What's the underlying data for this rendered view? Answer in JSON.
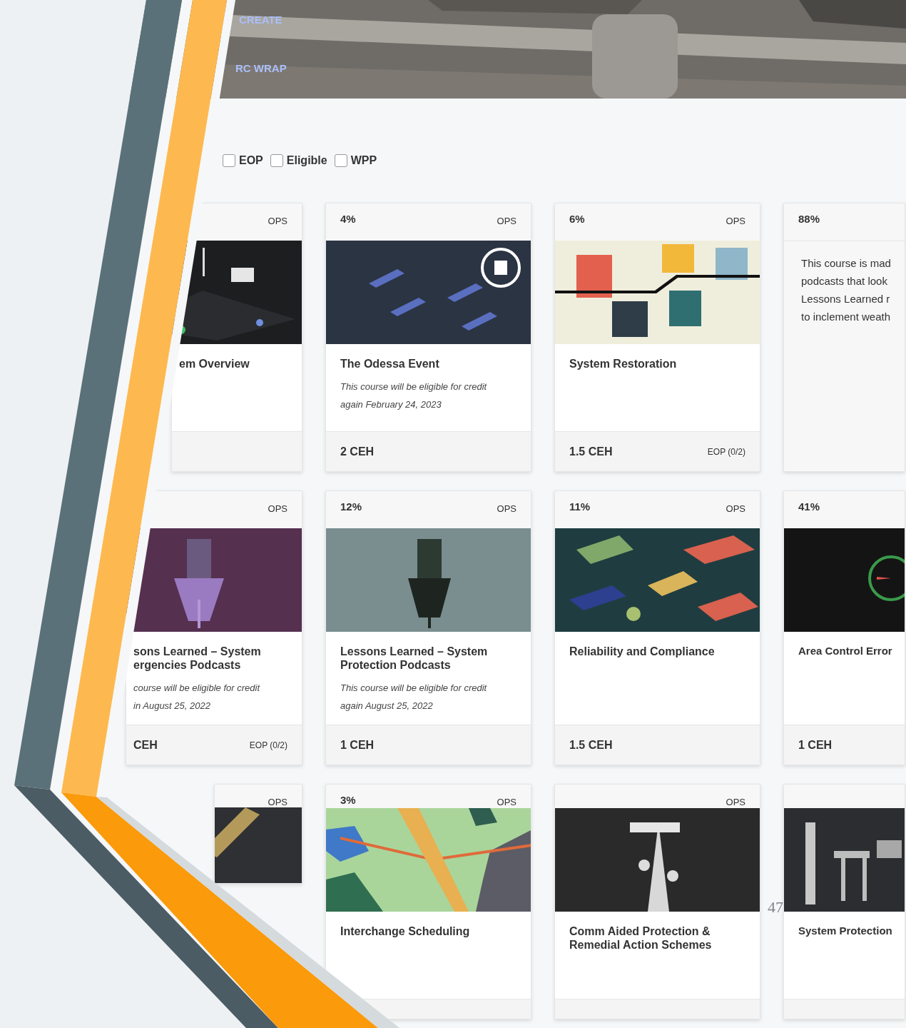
{
  "hero_links": [
    {
      "label": "CREATE"
    },
    {
      "label": "RC WRAP"
    }
  ],
  "filters": [
    {
      "label": "EOP",
      "checked": false
    },
    {
      "label": "Eligible",
      "checked": false
    },
    {
      "label": "WPP",
      "checked": false
    }
  ],
  "card_rows": [
    [
      {
        "tag": "OPS",
        "title": "em Overview"
      },
      {
        "percent": "4%",
        "tag": "OPS",
        "title": "The Odessa Event",
        "note": "This course will be eligible for credit\nagain February 24, 2023",
        "credits": "2 CEH"
      },
      {
        "percent": "6%",
        "tag": "OPS",
        "title": "System Restoration",
        "credits": "1.5 CEH",
        "eop": "EOP (0/2)"
      },
      {
        "percent": "88%",
        "description": [
          "This course is mad",
          "podcasts that look",
          "Lessons Learned r",
          "to inclement weath"
        ]
      }
    ],
    [
      {
        "tag": "OPS",
        "title": "sons Learned – System\nergencies Podcasts",
        "note": "course will be eligible for credit\nin August 25, 2022",
        "credits": "CEH",
        "eop": "EOP (0/2)"
      },
      {
        "percent": "12%",
        "tag": "OPS",
        "title": "Lessons Learned – System\nProtection Podcasts",
        "note": "This course will be eligible for credit\nagain August 25, 2022",
        "credits": "1 CEH"
      },
      {
        "percent": "11%",
        "tag": "OPS",
        "title": "Reliability and Compliance",
        "credits": "1.5 CEH"
      },
      {
        "percent": "41%",
        "title": "Area Control Error",
        "credits": "1 CEH"
      }
    ],
    [
      {
        "tag": "OPS"
      },
      {
        "percent": "3%",
        "tag": "OPS",
        "title": "Interchange Scheduling"
      },
      {
        "tag": "OPS",
        "title": "Comm Aided Protection &\nRemedial Action Schemes"
      },
      {
        "title": "System Protection"
      }
    ]
  ],
  "slide_number": "47"
}
